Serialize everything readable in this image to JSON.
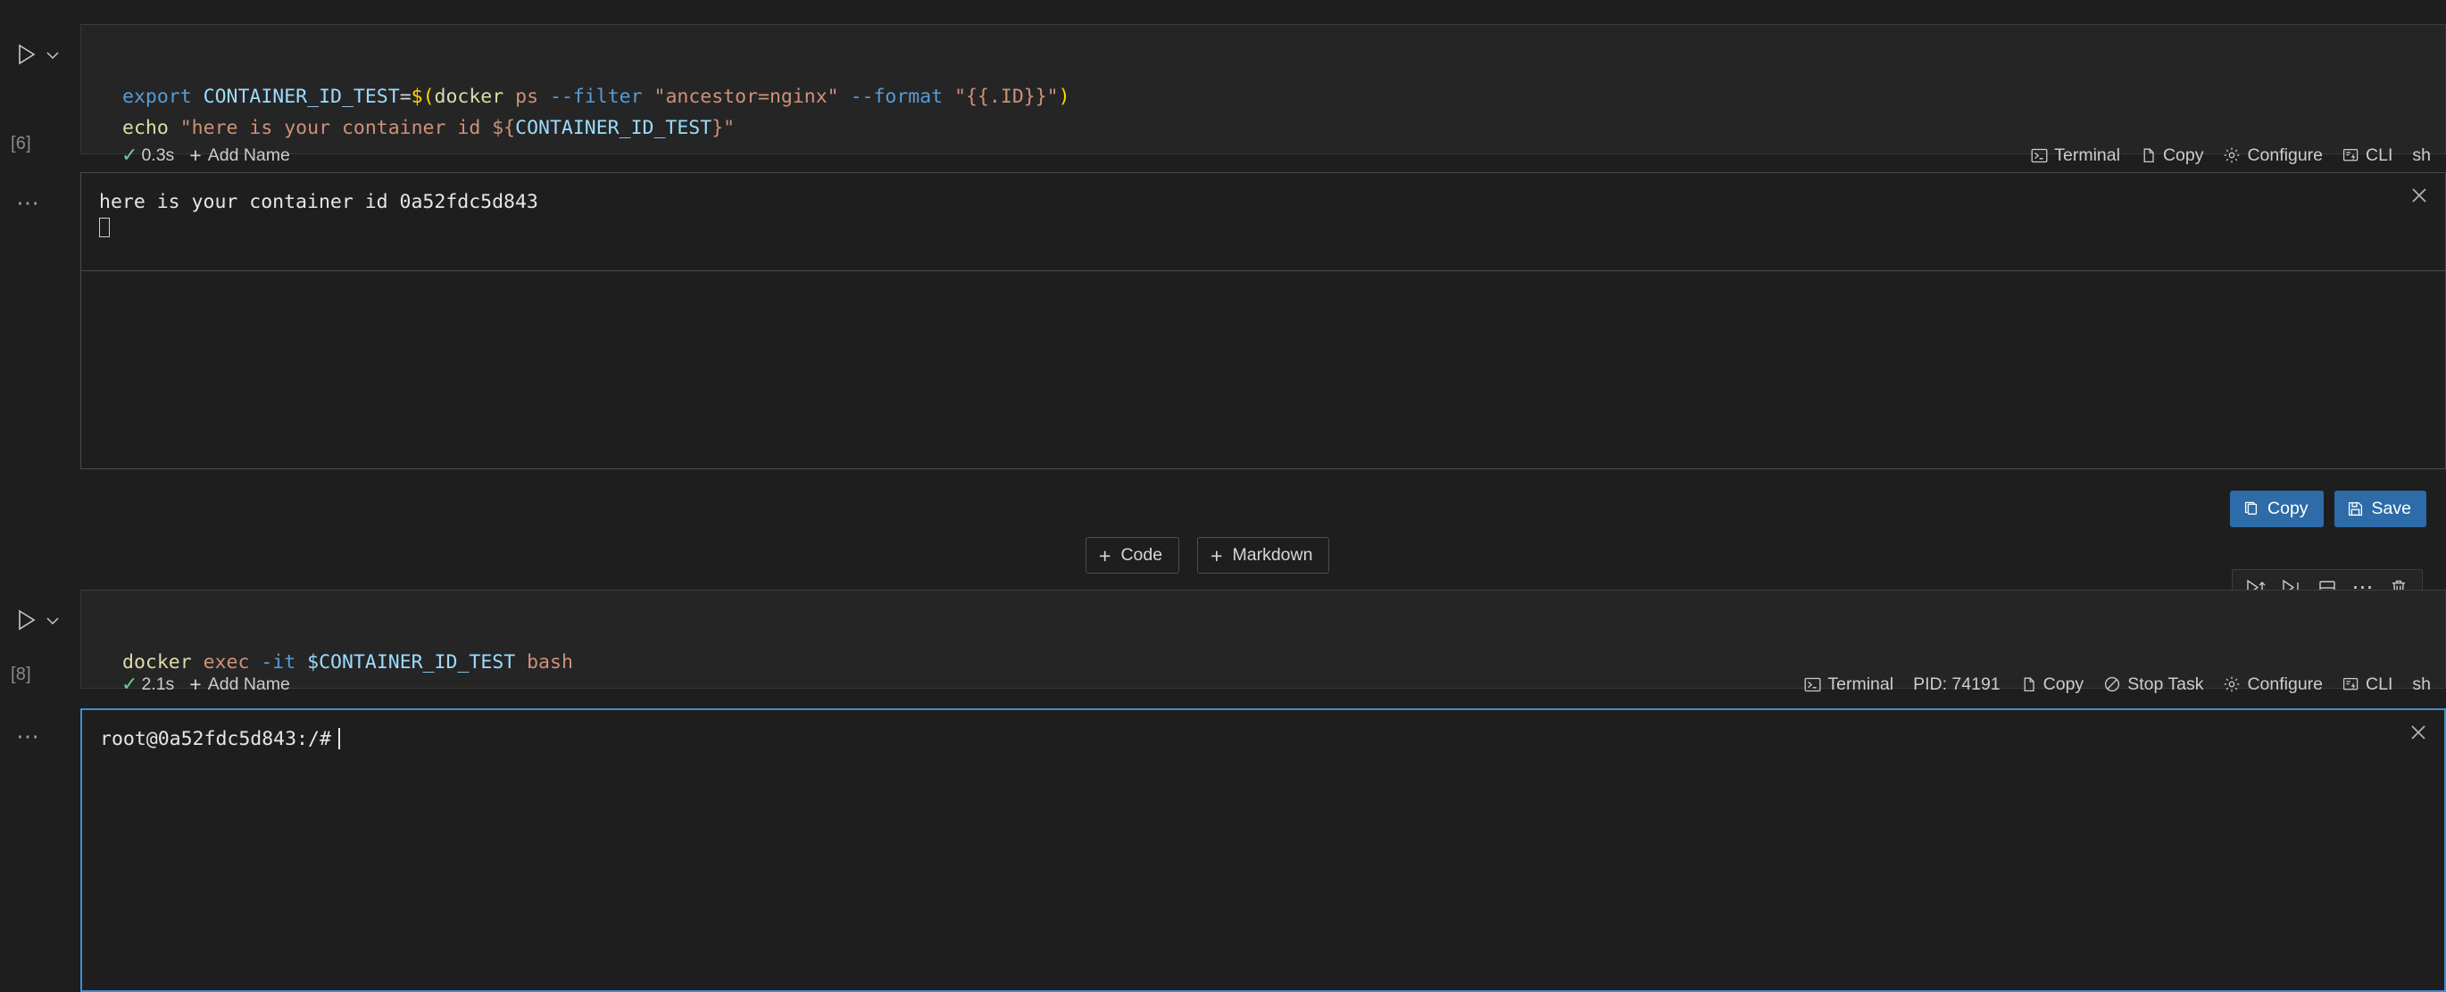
{
  "theme": {
    "page_bg": "#1e1e1e",
    "editor_bg": "#252526",
    "accent": "#2d6ca8",
    "focus_border": "#3f8ed0",
    "success": "#73c991"
  },
  "cells": [
    {
      "execution_count": "[6]",
      "language": "sh",
      "code_lines": [
        [
          {
            "t": "export",
            "c": "kw"
          },
          {
            "t": " ",
            "c": "plain"
          },
          {
            "t": "CONTAINER_ID_TEST",
            "c": "var"
          },
          {
            "t": "=",
            "c": "plain"
          },
          {
            "t": "$(",
            "c": "par"
          },
          {
            "t": "docker",
            "c": "fn"
          },
          {
            "t": " ",
            "c": "plain"
          },
          {
            "t": "ps",
            "c": "str"
          },
          {
            "t": " ",
            "c": "plain"
          },
          {
            "t": "--filter",
            "c": "opt"
          },
          {
            "t": " ",
            "c": "plain"
          },
          {
            "t": "\"ancestor=nginx\"",
            "c": "str"
          },
          {
            "t": " ",
            "c": "plain"
          },
          {
            "t": "--format",
            "c": "opt"
          },
          {
            "t": " ",
            "c": "plain"
          },
          {
            "t": "\"{{.ID}}\"",
            "c": "str"
          },
          {
            "t": ")",
            "c": "par"
          }
        ],
        [
          {
            "t": "echo",
            "c": "fn"
          },
          {
            "t": " ",
            "c": "plain"
          },
          {
            "t": "\"here is your container id ",
            "c": "str"
          },
          {
            "t": "${",
            "c": "str"
          },
          {
            "t": "CONTAINER_ID_TEST",
            "c": "var"
          },
          {
            "t": "}\"",
            "c": "str"
          }
        ]
      ],
      "status": {
        "duration": "0.3s",
        "add_name": "Add Name",
        "terminal": "Terminal",
        "copy": "Copy",
        "configure": "Configure",
        "cli": "CLI",
        "kernel": "sh"
      },
      "output": {
        "lines": [
          "here is your container id 0a52fdc5d843"
        ],
        "cursor": "block",
        "focused": false
      }
    },
    {
      "execution_count": "[8]",
      "language": "sh",
      "code_lines": [
        [
          {
            "t": "docker",
            "c": "fn"
          },
          {
            "t": " ",
            "c": "plain"
          },
          {
            "t": "exec",
            "c": "str"
          },
          {
            "t": " ",
            "c": "plain"
          },
          {
            "t": "-it",
            "c": "opt"
          },
          {
            "t": " ",
            "c": "plain"
          },
          {
            "t": "$CONTAINER_ID_TEST",
            "c": "var"
          },
          {
            "t": " ",
            "c": "plain"
          },
          {
            "t": "bash",
            "c": "str"
          }
        ]
      ],
      "status": {
        "duration": "2.1s",
        "add_name": "Add Name",
        "terminal": "Terminal",
        "pid": "PID: 74191",
        "copy": "Copy",
        "stop_task": "Stop Task",
        "configure": "Configure",
        "cli": "CLI",
        "kernel": "sh"
      },
      "output": {
        "lines": [
          "root@0a52fdc5d843:/#"
        ],
        "cursor": "bar",
        "focused": true
      }
    }
  ],
  "output_actions": {
    "copy": "Copy",
    "save": "Save"
  },
  "add_cell_bar": {
    "code": "Code",
    "markdown": "Markdown"
  },
  "cell_toolbar": {
    "run_above": "run-above",
    "run_below": "run-below",
    "split_cell": "split-cell",
    "more": "more-actions",
    "delete": "delete-cell"
  }
}
